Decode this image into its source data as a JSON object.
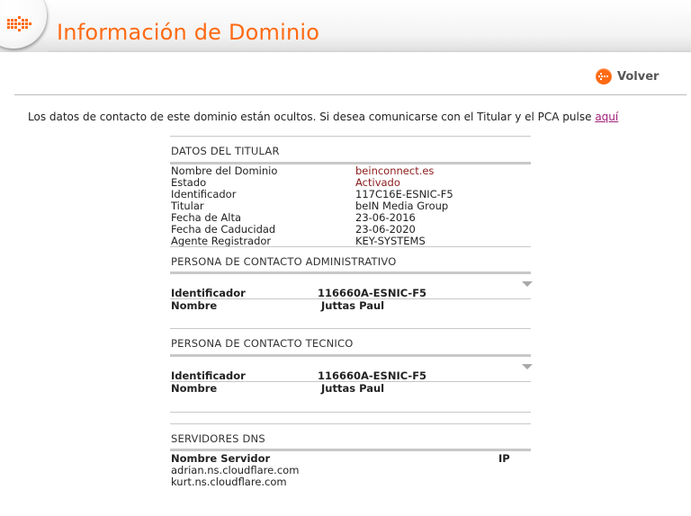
{
  "header": {
    "title": "Información de Dominio",
    "icon": "arrow-right-icon"
  },
  "back": {
    "label": "Volver",
    "icon": "arrow-left-icon"
  },
  "notice": {
    "text": "Los datos de contacto de este dominio están ocultos. Si desea comunicarse con el Titular y el PCA pulse",
    "link": "aquí"
  },
  "titular": {
    "title": "DATOS DEL TITULAR",
    "rows": [
      {
        "label": "Nombre del Dominio",
        "value": "beinconnect.es"
      },
      {
        "label": "Estado",
        "value": "Activado"
      },
      {
        "label": "Identificador",
        "value": "117C16E-ESNIC-F5"
      },
      {
        "label": "Titular",
        "value": "beIN Media Group"
      },
      {
        "label": "Fecha de Alta",
        "value": "23-06-2016"
      },
      {
        "label": "Fecha de Caducidad",
        "value": "23-06-2020"
      },
      {
        "label": "Agente Registrador",
        "value": "KEY-SYSTEMS"
      }
    ]
  },
  "admin_contact": {
    "title": "PERSONA DE CONTACTO ADMINISTRATIVO",
    "id_label": "Identificador",
    "id_value": "116660A-ESNIC-F5",
    "name_label": "Nombre",
    "name_value": "Juttas Paul"
  },
  "tech_contact": {
    "title": "PERSONA DE CONTACTO TECNICO",
    "id_label": "Identificador",
    "id_value": "116660A-ESNIC-F5",
    "name_label": "Nombre",
    "name_value": "Juttas Paul"
  },
  "dns": {
    "title": "SERVIDORES DNS",
    "col_name": "Nombre Servidor",
    "col_ip": "IP",
    "servers": [
      "adrian.ns.cloudflare.com",
      "kurt.ns.cloudflare.com"
    ]
  },
  "colors": {
    "accent": "#ff6a13",
    "value_red": "#8b1a1a",
    "link": "#a0207a"
  }
}
